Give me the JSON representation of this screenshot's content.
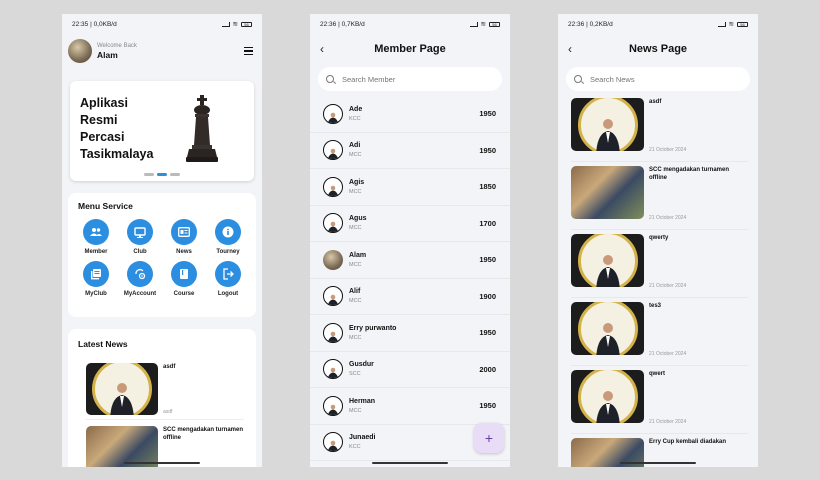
{
  "screen1": {
    "status": {
      "time": "22:35 | 0,0KB/d",
      "battery": "56"
    },
    "header": {
      "welcome": "Welcome Back",
      "username": "Alam"
    },
    "banner": {
      "line1": "Aplikasi",
      "line2": "Resmi",
      "line3": "Percasi",
      "line4": "Tasikmalaya"
    },
    "menu": {
      "title": "Menu Service",
      "items": [
        {
          "label": "Member",
          "icon": "people-icon"
        },
        {
          "label": "Club",
          "icon": "monitor-icon"
        },
        {
          "label": "News",
          "icon": "newspaper-icon"
        },
        {
          "label": "Tourney",
          "icon": "info-icon"
        },
        {
          "label": "MyClub",
          "icon": "library-icon"
        },
        {
          "label": "MyAccount",
          "icon": "account-settings-icon"
        },
        {
          "label": "Course",
          "icon": "book-icon"
        },
        {
          "label": "Logout",
          "icon": "logout-icon"
        }
      ]
    },
    "news": {
      "title": "Latest News",
      "items": [
        {
          "title": "asdf",
          "meta": "asdf"
        },
        {
          "title": "SCC mengadakan turnamen offline",
          "meta": ""
        }
      ]
    }
  },
  "screen2": {
    "status": {
      "time": "22:36 | 0,7KB/d",
      "battery": "56"
    },
    "title": "Member Page",
    "search_placeholder": "Search Member",
    "members": [
      {
        "name": "Ade",
        "club": "KCC",
        "rating": "1950"
      },
      {
        "name": "Adi",
        "club": "MCC",
        "rating": "1950"
      },
      {
        "name": "Agis",
        "club": "MCC",
        "rating": "1850"
      },
      {
        "name": "Agus",
        "club": "MCC",
        "rating": "1700"
      },
      {
        "name": "Alam",
        "club": "MCC",
        "rating": "1950"
      },
      {
        "name": "Alif",
        "club": "MCC",
        "rating": "1900"
      },
      {
        "name": "Erry purwanto",
        "club": "MCC",
        "rating": "1950"
      },
      {
        "name": "Gusdur",
        "club": "SCC",
        "rating": "2000"
      },
      {
        "name": "Herman",
        "club": "MCC",
        "rating": "1950"
      },
      {
        "name": "Junaedi",
        "club": "KCC",
        "rating": ""
      }
    ],
    "fab": "+"
  },
  "screen3": {
    "status": {
      "time": "22:36 | 0,2KB/d",
      "battery": "56"
    },
    "title": "News Page",
    "search_placeholder": "Search News",
    "news": [
      {
        "title": "asdf",
        "date": "21 October 2024"
      },
      {
        "title": "SCC mengadakan turnamen offline",
        "date": "21 October 2024"
      },
      {
        "title": "qwerty",
        "date": "21 October 2024"
      },
      {
        "title": "tes3",
        "date": "21 October 2024"
      },
      {
        "title": "qwert",
        "date": "21 October 2024"
      },
      {
        "title": "Erry Cup kembali diadakan",
        "date": ""
      }
    ]
  },
  "colors": {
    "accent": "#2b8ee0",
    "fab_bg": "#e8dcf6",
    "thumb_ring": "#d4b24a"
  }
}
